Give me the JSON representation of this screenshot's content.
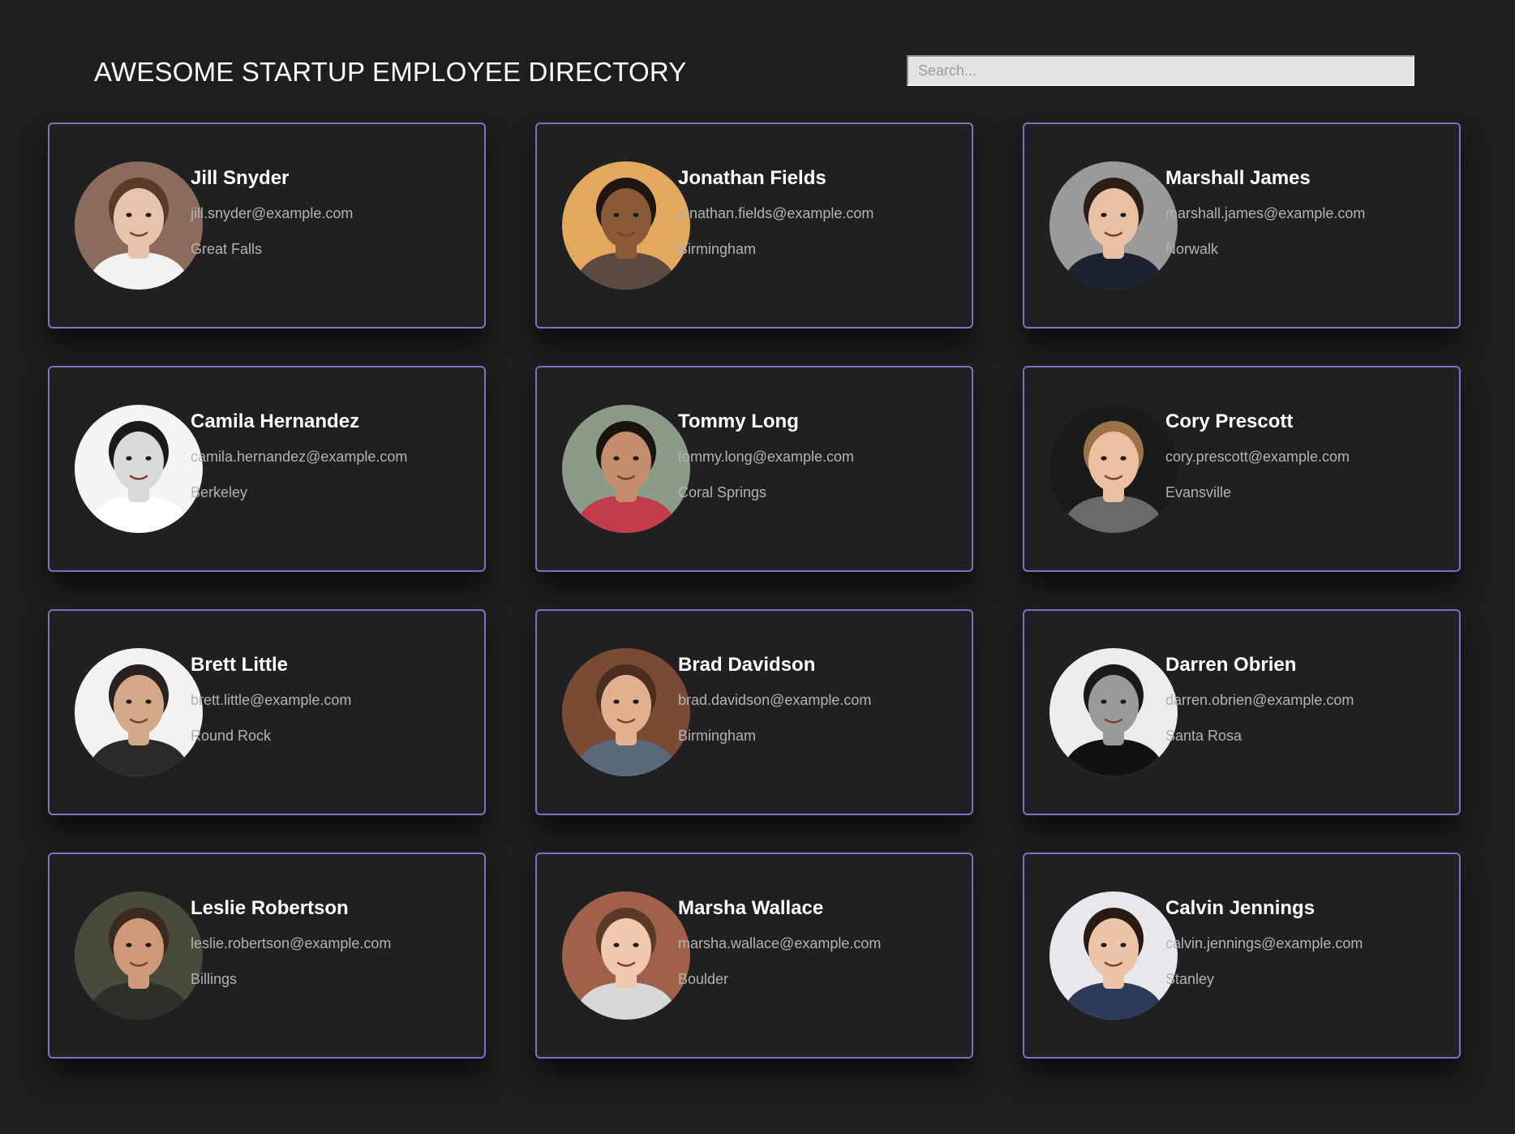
{
  "header": {
    "title": "AWESOME STARTUP EMPLOYEE DIRECTORY",
    "search_placeholder": "Search..."
  },
  "colors": {
    "background": "#1e1e1f",
    "card_background": "#202022",
    "card_border": "#7a73c0",
    "name_text": "#ffffff",
    "detail_text": "#b3b3b3"
  },
  "employees": [
    {
      "name": "Jill Snyder",
      "email": "jill.snyder@example.com",
      "city": "Great Falls",
      "photo": {
        "bg": "#8a6b5c",
        "skin": "#e8c3ad",
        "hair": "#5a3a28",
        "shirt": "#f2f2f2"
      }
    },
    {
      "name": "Jonathan Fields",
      "email": "jonathan.fields@example.com",
      "city": "Birmingham",
      "photo": {
        "bg": "#e3a75e",
        "skin": "#8a5a38",
        "hair": "#1e1410",
        "shirt": "#5a4a40"
      }
    },
    {
      "name": "Marshall James",
      "email": "marshall.james@example.com",
      "city": "Norwalk",
      "photo": {
        "bg": "#9a9a9a",
        "skin": "#e8c0a3",
        "hair": "#2a1e16",
        "shirt": "#1c2230"
      }
    },
    {
      "name": "Camila Hernandez",
      "email": "camila.hernandez@example.com",
      "city": "Berkeley",
      "photo": {
        "bg": "#f4f4f4",
        "skin": "#d9d9d9",
        "hair": "#1a1a1a",
        "shirt": "#ffffff"
      }
    },
    {
      "name": "Tommy Long",
      "email": "tommy.long@example.com",
      "city": "Coral Springs",
      "photo": {
        "bg": "#8c9a88",
        "skin": "#c48e6c",
        "hair": "#1a1410",
        "shirt": "#c23c4a"
      }
    },
    {
      "name": "Cory Prescott",
      "email": "cory.prescott@example.com",
      "city": "Evansville",
      "photo": {
        "bg": "#1a1a1a",
        "skin": "#eac0a0",
        "hair": "#9a7448",
        "shirt": "#6a6a6a"
      }
    },
    {
      "name": "Brett Little",
      "email": "brett.little@example.com",
      "city": "Round Rock",
      "photo": {
        "bg": "#f2f2f2",
        "skin": "#d2a888",
        "hair": "#2a2220",
        "shirt": "#2a2a2a"
      }
    },
    {
      "name": "Brad Davidson",
      "email": "brad.davidson@example.com",
      "city": "Birmingham",
      "photo": {
        "bg": "#7a4a34",
        "skin": "#e2b08e",
        "hair": "#4a2e1e",
        "shirt": "#5a6a7a"
      }
    },
    {
      "name": "Darren Obrien",
      "email": "darren.obrien@example.com",
      "city": "Santa Rosa",
      "photo": {
        "bg": "#ececec",
        "skin": "#9a9a9a",
        "hair": "#1a1a1a",
        "shirt": "#111111"
      }
    },
    {
      "name": "Leslie Robertson",
      "email": "leslie.robertson@example.com",
      "city": "Billings",
      "photo": {
        "bg": "#4a4a3a",
        "skin": "#d09a78",
        "hair": "#3a2a20",
        "shirt": "#2e2e2a"
      }
    },
    {
      "name": "Marsha Wallace",
      "email": "marsha.wallace@example.com",
      "city": "Boulder",
      "photo": {
        "bg": "#a0604a",
        "skin": "#f0c8b0",
        "hair": "#5a3a26",
        "shirt": "#d8d8d8"
      }
    },
    {
      "name": "Calvin Jennings",
      "email": "calvin.jennings@example.com",
      "city": "Stanley",
      "photo": {
        "bg": "#e8e8ec",
        "skin": "#ecc4a8",
        "hair": "#2a1a14",
        "shirt": "#2e3a5a"
      }
    }
  ]
}
